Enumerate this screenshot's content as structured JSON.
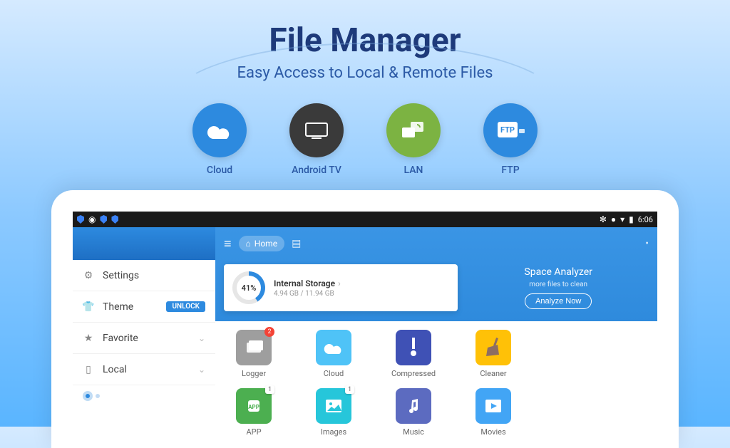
{
  "hero": {
    "title": "File Manager",
    "subtitle": "Easy Access to Local & Remote Files"
  },
  "features": [
    {
      "label": "Cloud",
      "color": "#2d8adf"
    },
    {
      "label": "Android TV",
      "color": "#3a3a3a"
    },
    {
      "label": "LAN",
      "color": "#7cb342"
    },
    {
      "label": "FTP",
      "color": "#2d8adf"
    }
  ],
  "statusbar": {
    "time": "6:06"
  },
  "sidebar": {
    "items": [
      {
        "label": "Settings"
      },
      {
        "label": "Theme",
        "badge": "UNLOCK"
      },
      {
        "label": "Favorite",
        "chevron": true
      },
      {
        "label": "Local",
        "chevron": true
      }
    ]
  },
  "topbar": {
    "home_label": "Home"
  },
  "storage": {
    "percent": "41%",
    "title": "Internal Storage",
    "used": "4.94 GB / 11.94 GB"
  },
  "analyzer": {
    "title": "Space Analyzer",
    "subtitle": "more files to clean",
    "button": "Analyze Now"
  },
  "grid": {
    "row1": [
      {
        "label": "Logger",
        "bg": "#9e9e9e",
        "badge_red": "2"
      },
      {
        "label": "Cloud",
        "bg": "#4fc3f7"
      },
      {
        "label": "Compressed",
        "bg": "#3f51b5"
      },
      {
        "label": "Cleaner",
        "bg": "#ffc107"
      }
    ],
    "row2": [
      {
        "label": "APP",
        "bg": "#4caf50",
        "badge_white": "1"
      },
      {
        "label": "Images",
        "bg": "#26c6da",
        "badge_white": "1"
      },
      {
        "label": "Music",
        "bg": "#5c6bc0"
      },
      {
        "label": "Movies",
        "bg": "#42a5f5"
      }
    ]
  }
}
